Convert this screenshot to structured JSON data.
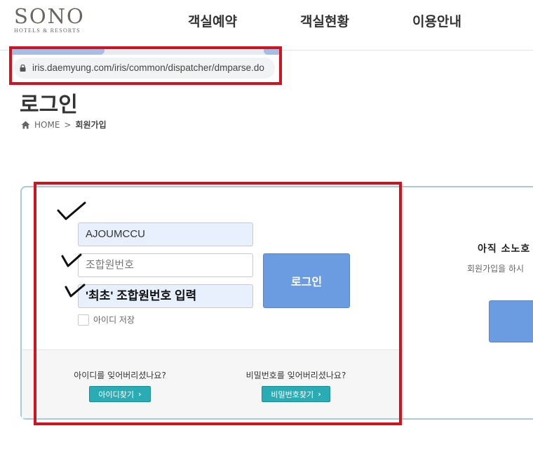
{
  "header": {
    "logo_main": "SONO",
    "logo_sub": "HOTELS & RESORTS",
    "nav": [
      "객실예약",
      "객실현황",
      "이용안내"
    ]
  },
  "browser": {
    "url": "iris.daemyung.com/iris/common/dispatcher/dmparse.do"
  },
  "page": {
    "title": "로그인",
    "breadcrumb": {
      "home": "HOME",
      "separator": ">",
      "current": "회원가입"
    }
  },
  "login_form": {
    "id_value": "AJOUMCCU",
    "password_placeholder": "조합원번호",
    "password2_annotation": "'최초' 조합원번호 입력",
    "login_button": "로그인",
    "save_id_label": "아이디 저장"
  },
  "recovery": {
    "forgot_id_text": "아이디를 잊어버리셨나요?",
    "forgot_id_button": "아이디찾기",
    "forgot_pw_text": "비밀번호를 잊어버리셨나요?",
    "forgot_pw_button": "비밀번호찾기"
  },
  "signup": {
    "title": "아직 소노호",
    "description": "회원가입을 하시"
  },
  "colors": {
    "annotation_red": "#d0141f",
    "button_blue": "#6b9be1",
    "teal": "#2aacb4",
    "panel_border": "#a9cbd7"
  },
  "icons": [
    "lock-icon",
    "home-icon",
    "chevron-right-icon",
    "check-mark-icon"
  ]
}
